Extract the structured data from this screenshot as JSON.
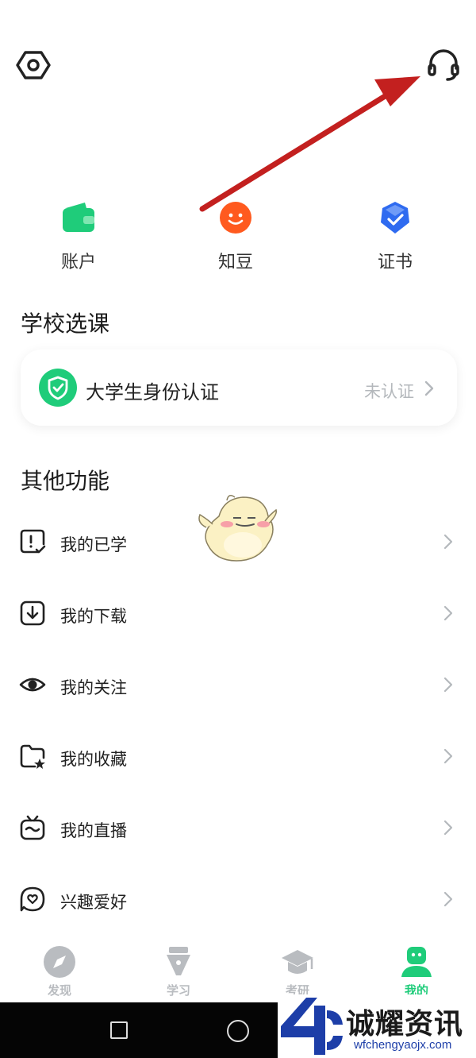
{
  "quick_actions": [
    {
      "label": "账户",
      "icon": "wallet-icon",
      "color": "#1fcc7a"
    },
    {
      "label": "知豆",
      "icon": "smiley-bean-icon",
      "color": "#ff5a1f"
    },
    {
      "label": "证书",
      "icon": "certificate-badge-icon",
      "color": "#2f6bf0"
    }
  ],
  "sections": {
    "school_title": "学校选课",
    "other_title": "其他功能"
  },
  "verify": {
    "title": "大学生身份认证",
    "status": "未认证",
    "icon": "shield-check-icon",
    "color": "#1fcc7a"
  },
  "menu": [
    {
      "label": "我的已学",
      "icon": "learned-icon"
    },
    {
      "label": "我的下载",
      "icon": "download-icon"
    },
    {
      "label": "我的关注",
      "icon": "eye-icon"
    },
    {
      "label": "我的收藏",
      "icon": "star-folder-icon"
    },
    {
      "label": "我的直播",
      "icon": "tv-live-icon"
    },
    {
      "label": "兴趣爱好",
      "icon": "heart-tag-icon"
    }
  ],
  "tabs": [
    {
      "label": "发现",
      "icon": "compass-icon",
      "active": false
    },
    {
      "label": "学习",
      "icon": "pen-nib-icon",
      "active": false
    },
    {
      "label": "考研",
      "icon": "graduation-cap-icon",
      "active": false
    },
    {
      "label": "我的",
      "icon": "person-icon",
      "active": true
    }
  ],
  "watermark": {
    "name": "诚耀资讯",
    "url": "wfchengyaojx.com"
  },
  "colors": {
    "accent": "#1fcc7a",
    "annotation_arrow": "#c3201f",
    "inactive_tab": "#b9bcc0"
  }
}
